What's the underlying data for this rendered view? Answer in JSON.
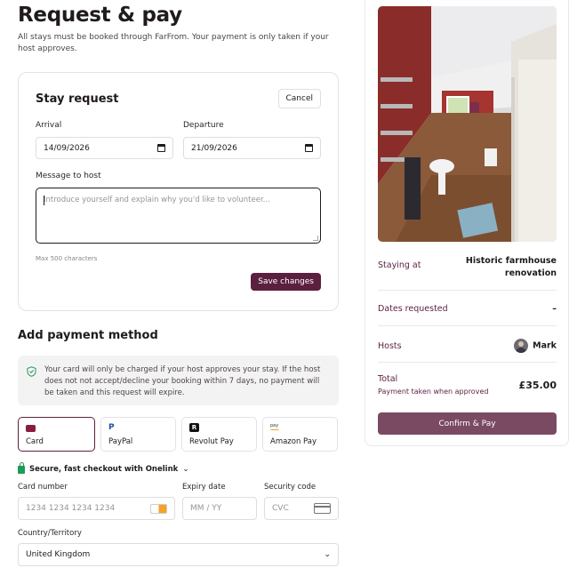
{
  "page": {
    "title": "Request & pay",
    "subtitle": "All stays must be booked through FarFrom. Your payment is only taken if your host approves."
  },
  "stay_request": {
    "title": "Stay request",
    "cancel_label": "Cancel",
    "arrival_label": "Arrival",
    "arrival_value": "14/09/2026",
    "departure_label": "Departure",
    "departure_value": "21/09/2026",
    "message_label": "Message to host",
    "message_placeholder": "Introduce yourself and explain why you'd like to volunteer...",
    "max_chars": "Max 500 characters",
    "save_label": "Save changes"
  },
  "payment": {
    "title": "Add payment method",
    "notice": "Your card will only be charged if your host approves your stay. If the host does not not accept/decline your booking within 7 days, no payment will be taken and this request will expire.",
    "methods": [
      {
        "label": "Card",
        "icon": "card-icon",
        "selected": true
      },
      {
        "label": "PayPal",
        "icon": "paypal-icon",
        "selected": false
      },
      {
        "label": "Revolut Pay",
        "icon": "revolut-icon",
        "selected": false
      },
      {
        "label": "Amazon Pay",
        "icon": "amazon-pay-icon",
        "selected": false
      }
    ],
    "onelink": "Secure, fast checkout with Onelink",
    "card_number_label": "Card number",
    "card_number_placeholder": "1234 1234 1234 1234",
    "expiry_label": "Expiry date",
    "expiry_placeholder": "MM / YY",
    "security_label": "Security code",
    "security_placeholder": "CVC",
    "country_label": "Country/Territory",
    "country_value": "United Kingdom"
  },
  "summary": {
    "staying_at_label": "Staying at",
    "staying_at_value": "Historic farmhouse renovation",
    "dates_label": "Dates requested",
    "dates_value": "–",
    "hosts_label": "Hosts",
    "host_name": "Mark",
    "total_label": "Total",
    "total_sub": "Payment taken when approved",
    "total_value": "£35.00",
    "confirm_label": "Confirm & Pay"
  },
  "colors": {
    "brand": "#5b1f3f",
    "confirm_button": "#7a4a63",
    "secure_green": "#1e9a5a"
  }
}
